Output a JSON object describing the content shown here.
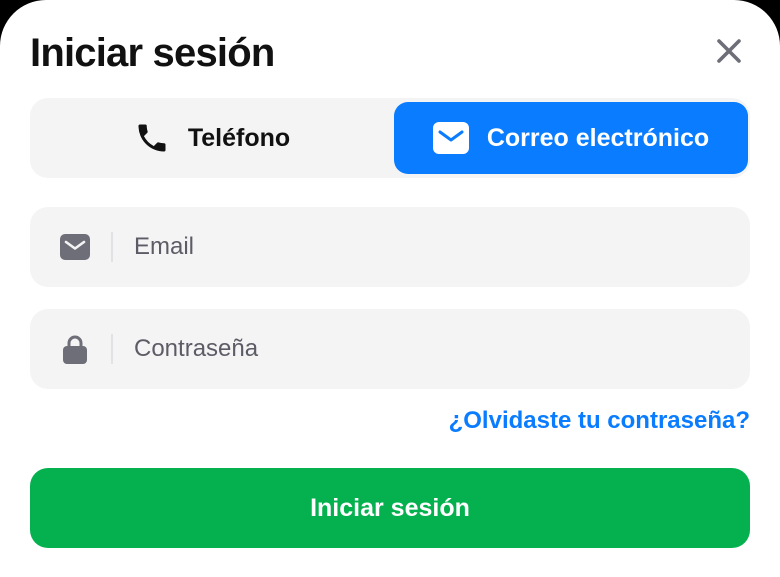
{
  "dialog": {
    "title": "Iniciar sesión",
    "close_icon": "close-icon"
  },
  "tabs": [
    {
      "label": "Teléfono",
      "icon": "phone-icon",
      "selected": false
    },
    {
      "label": "Correo electrónico",
      "icon": "envelope-icon",
      "selected": true
    }
  ],
  "form": {
    "email": {
      "placeholder": "Email",
      "value": "",
      "icon": "envelope-icon"
    },
    "password": {
      "placeholder": "Contraseña",
      "value": "",
      "icon": "lock-icon"
    },
    "forgot_label": "¿Olvidaste tu contraseña?",
    "submit_label": "Iniciar sesión"
  },
  "colors": {
    "accent": "#0a7cff",
    "submit": "#04b14e",
    "field_bg": "#f4f4f5",
    "icon_gray": "#6e6e78"
  }
}
